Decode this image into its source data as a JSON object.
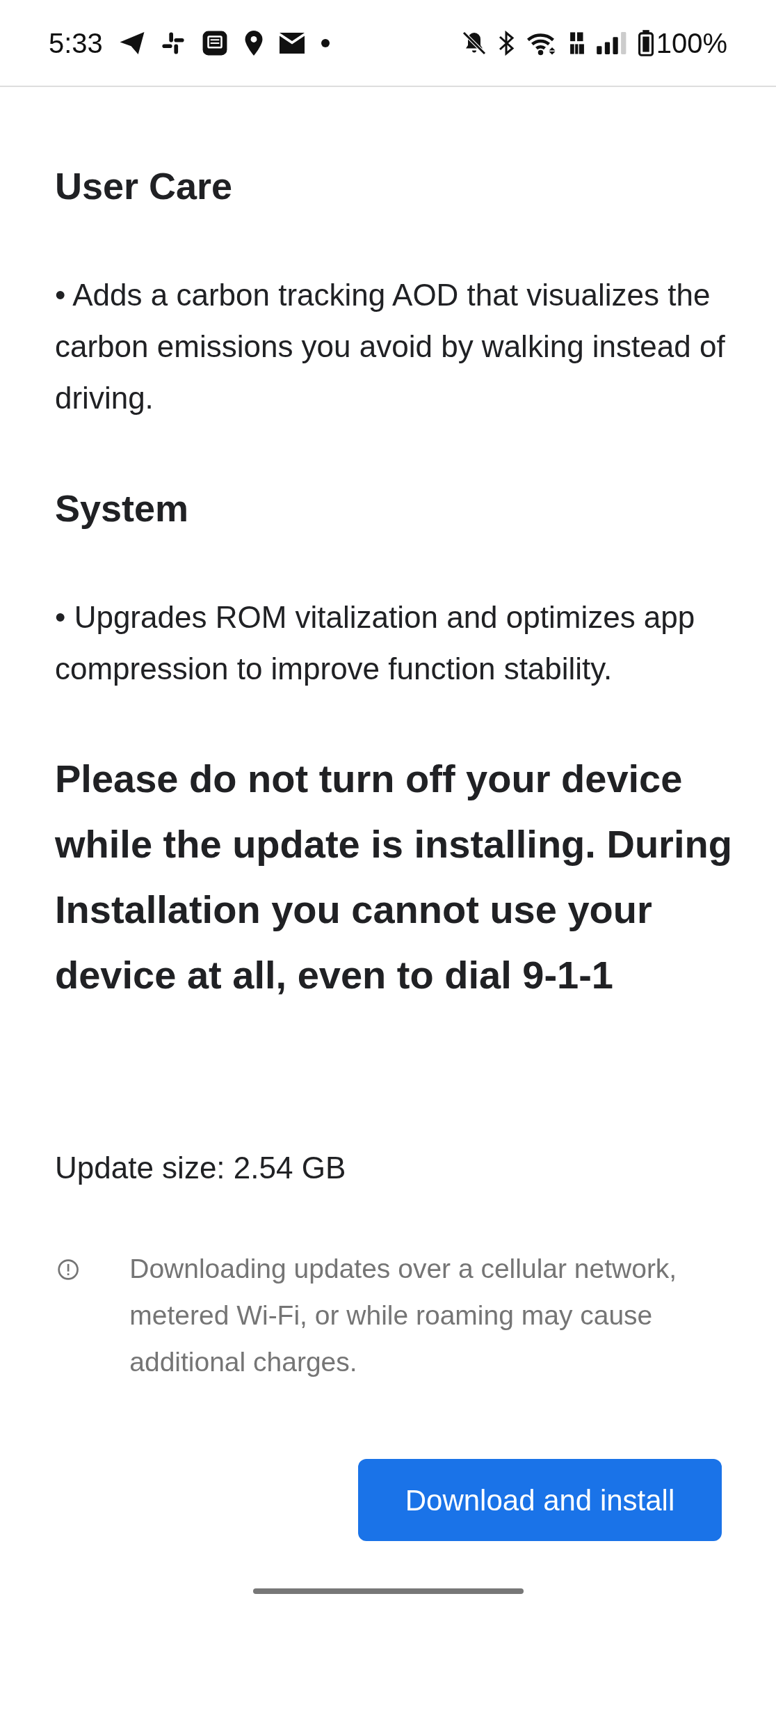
{
  "status_bar": {
    "time": "5:33",
    "battery": "100%"
  },
  "sections": [
    {
      "heading": "User Care",
      "bullets": [
        "• Adds a carbon tracking AOD that visualizes the carbon emissions you avoid by walking instead of driving."
      ]
    },
    {
      "heading": "System",
      "bullets": [
        "• Upgrades ROM vitalization and optimizes app compression to improve function stability."
      ]
    }
  ],
  "warning": "Please do not turn off your device while the update is installing. During Installation you cannot use your device at all, even to dial 9-1-1",
  "update_size": "Update size: 2.54 GB",
  "data_notice": "Downloading updates over a cellular network, metered Wi-Fi, or while roaming may cause additional charges.",
  "button": {
    "label": "Download and install"
  }
}
